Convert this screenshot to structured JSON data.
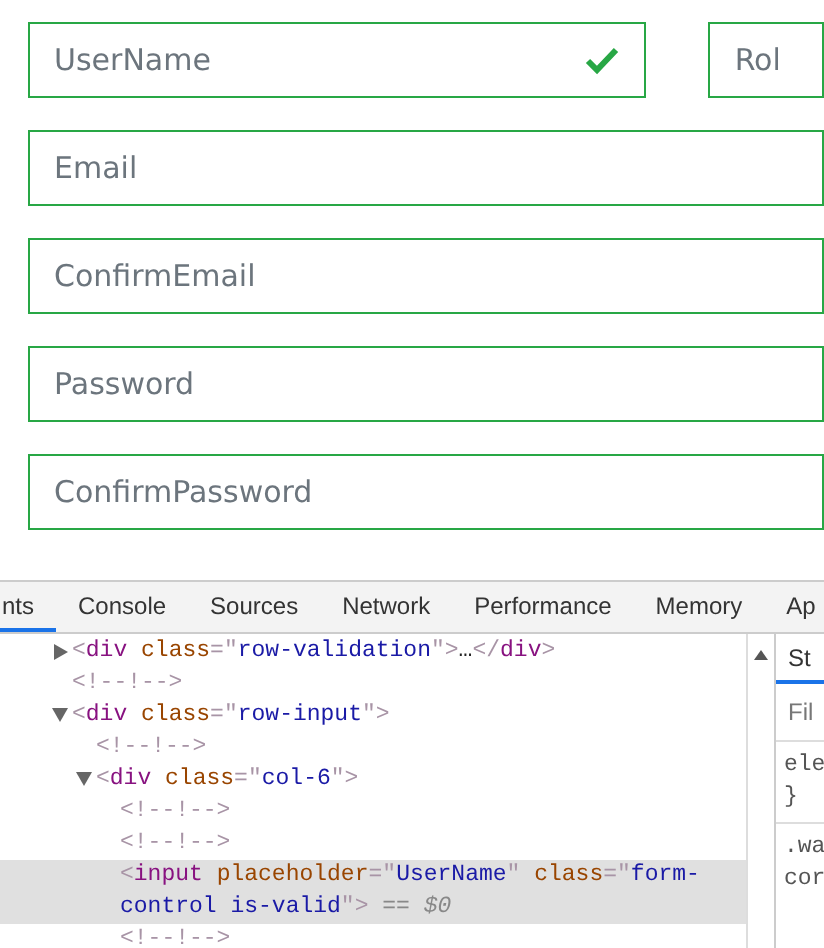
{
  "form": {
    "rows": [
      {
        "fields": [
          {
            "placeholder": "UserName",
            "valid": true,
            "check": true
          },
          {
            "placeholder": "Rol",
            "valid": true,
            "check": false
          }
        ]
      },
      {
        "fields": [
          {
            "placeholder": "Email",
            "valid": true,
            "check": false
          }
        ]
      },
      {
        "fields": [
          {
            "placeholder": "ConfirmEmail",
            "valid": true,
            "check": false
          }
        ]
      },
      {
        "fields": [
          {
            "placeholder": "Password",
            "valid": true,
            "check": false
          }
        ]
      },
      {
        "fields": [
          {
            "placeholder": "ConfirmPassword",
            "valid": true,
            "check": false
          }
        ]
      }
    ]
  },
  "devtools": {
    "tabs": [
      {
        "label": "nts",
        "selected": true
      },
      {
        "label": "Console",
        "selected": false
      },
      {
        "label": "Sources",
        "selected": false
      },
      {
        "label": "Network",
        "selected": false
      },
      {
        "label": "Performance",
        "selected": false
      },
      {
        "label": "Memory",
        "selected": false
      },
      {
        "label": "Ap",
        "selected": false
      }
    ],
    "dom_tree": [
      {
        "expanded": false,
        "selected": false,
        "tokens": [
          {
            "kind": "punct",
            "text": "<"
          },
          {
            "kind": "tag",
            "text": "div"
          },
          {
            "kind": "attr",
            "text": " class"
          },
          {
            "kind": "punct",
            "text": "=\""
          },
          {
            "kind": "value",
            "text": "row-validation"
          },
          {
            "kind": "punct",
            "text": "\">"
          },
          {
            "kind": "plain",
            "text": "…"
          },
          {
            "kind": "punct",
            "text": "</"
          },
          {
            "kind": "tag",
            "text": "div"
          },
          {
            "kind": "punct",
            "text": ">"
          }
        ]
      },
      {
        "selected": false,
        "tokens": [
          {
            "kind": "punct",
            "text": "<!--!-->"
          }
        ]
      },
      {
        "expanded": true,
        "selected": false,
        "tokens": [
          {
            "kind": "punct",
            "text": "<"
          },
          {
            "kind": "tag",
            "text": "div"
          },
          {
            "kind": "attr",
            "text": " class"
          },
          {
            "kind": "punct",
            "text": "=\""
          },
          {
            "kind": "value",
            "text": "row-input"
          },
          {
            "kind": "punct",
            "text": "\">"
          }
        ],
        "children": [
          {
            "selected": false,
            "tokens": [
              {
                "kind": "punct",
                "text": "<!--!-->"
              }
            ]
          },
          {
            "expanded": true,
            "selected": false,
            "tokens": [
              {
                "kind": "punct",
                "text": "<"
              },
              {
                "kind": "tag",
                "text": "div"
              },
              {
                "kind": "attr",
                "text": " class"
              },
              {
                "kind": "punct",
                "text": "=\""
              },
              {
                "kind": "value",
                "text": "col-6"
              },
              {
                "kind": "punct",
                "text": "\">"
              }
            ],
            "children": [
              {
                "selected": false,
                "tokens": [
                  {
                    "kind": "punct",
                    "text": "<!--!-->"
                  }
                ]
              },
              {
                "selected": false,
                "tokens": [
                  {
                    "kind": "punct",
                    "text": "<!--!-->"
                  }
                ]
              },
              {
                "selected": true,
                "tokens": [
                  {
                    "kind": "punct",
                    "text": "<"
                  },
                  {
                    "kind": "tag",
                    "text": "input"
                  },
                  {
                    "kind": "attr",
                    "text": " placeholder"
                  },
                  {
                    "kind": "punct",
                    "text": "=\""
                  },
                  {
                    "kind": "value",
                    "text": "UserName"
                  },
                  {
                    "kind": "punct",
                    "text": "\""
                  },
                  {
                    "kind": "attr",
                    "text": " class"
                  },
                  {
                    "kind": "punct",
                    "text": "=\""
                  },
                  {
                    "kind": "value",
                    "text": "form-control is-valid"
                  },
                  {
                    "kind": "punct",
                    "text": "\">"
                  },
                  {
                    "kind": "note",
                    "text": " == $0"
                  }
                ]
              },
              {
                "selected": false,
                "tokens": [
                  {
                    "kind": "punct",
                    "text": "<!--!-->"
                  }
                ]
              }
            ]
          }
        ]
      }
    ],
    "styles_pane": {
      "tab": {
        "label": "St",
        "selected": true
      },
      "filter": {
        "placeholder": "Fil"
      },
      "lines": [
        "ele",
        "}"
      ],
      "rule_lines": [
        ".wa",
        "cor"
      ]
    }
  }
}
